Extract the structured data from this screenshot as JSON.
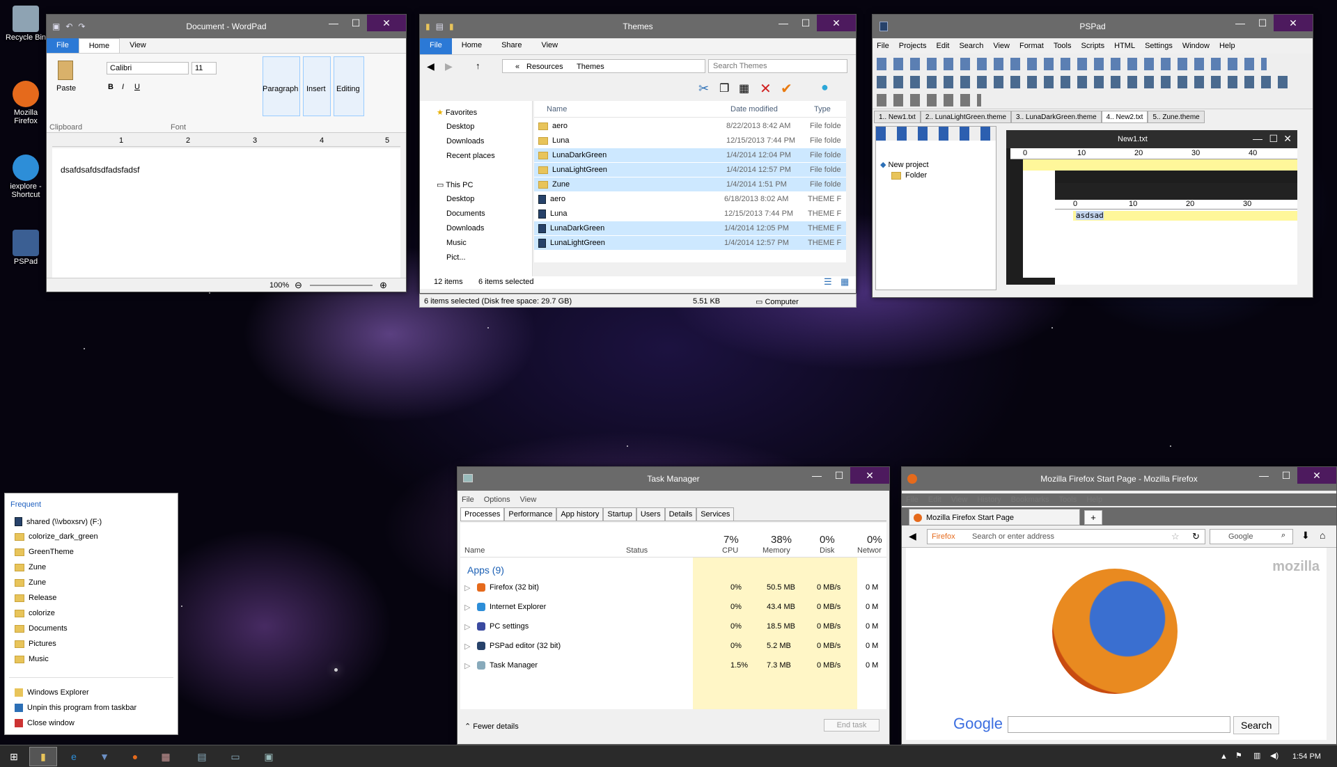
{
  "desktop": {
    "icons": [
      {
        "label": "Recycle Bin",
        "color": "#8ea3b3"
      },
      {
        "label": "Mozilla Firefox",
        "color": "#e56a1c"
      },
      {
        "label": "iexplore - Shortcut",
        "color": "#2d8ed8"
      },
      {
        "label": "PSPad",
        "color": "#3b5f93"
      }
    ]
  },
  "wordpad": {
    "title": "Document - WordPad",
    "tabs": [
      "File",
      "Home",
      "View"
    ],
    "font": "Calibri",
    "size": "11",
    "buttons": [
      "Paste",
      "Paragraph",
      "Insert",
      "Editing"
    ],
    "groups": [
      "Clipboard",
      "Font"
    ],
    "ruler": [
      "1",
      "2",
      "3",
      "4",
      "5"
    ],
    "content": "dsafdsafdsdfadsfadsf",
    "zoom": "100%"
  },
  "explorer": {
    "title": "Themes",
    "tabs": [
      "File",
      "Home",
      "Share",
      "View"
    ],
    "path": [
      "«",
      "Resources",
      "Themes"
    ],
    "search_placeholder": "Search Themes",
    "nav": {
      "favorites": "Favorites",
      "fav_items": [
        "Desktop",
        "Downloads",
        "Recent places"
      ],
      "thispc": "This PC",
      "pc_items": [
        "Desktop",
        "Documents",
        "Downloads",
        "Music",
        "Pict..."
      ]
    },
    "columns": [
      "Name",
      "Date modified",
      "Type"
    ],
    "files": [
      {
        "name": "aero",
        "date": "8/22/2013 8:42 AM",
        "type": "File folde",
        "kind": "folder",
        "sel": false
      },
      {
        "name": "Luna",
        "date": "12/15/2013 7:44 PM",
        "type": "File folde",
        "kind": "folder",
        "sel": false
      },
      {
        "name": "LunaDarkGreen",
        "date": "1/4/2014 12:04 PM",
        "type": "File folde",
        "kind": "folder",
        "sel": true
      },
      {
        "name": "LunaLightGreen",
        "date": "1/4/2014 12:57 PM",
        "type": "File folde",
        "kind": "folder",
        "sel": true
      },
      {
        "name": "Zune",
        "date": "1/4/2014 1:51 PM",
        "type": "File folde",
        "kind": "folder",
        "sel": true
      },
      {
        "name": "aero",
        "date": "6/18/2013 8:02 AM",
        "type": "THEME F",
        "kind": "theme",
        "sel": false
      },
      {
        "name": "Luna",
        "date": "12/15/2013 7:44 PM",
        "type": "THEME F",
        "kind": "theme",
        "sel": false
      },
      {
        "name": "LunaDarkGreen",
        "date": "1/4/2014 12:05 PM",
        "type": "THEME F",
        "kind": "theme",
        "sel": true
      },
      {
        "name": "LunaLightGreen",
        "date": "1/4/2014 12:57 PM",
        "type": "THEME F",
        "kind": "theme",
        "sel": true
      }
    ],
    "status_items": "12 items",
    "status_sel": "6 items selected",
    "status_bar": "6 items selected (Disk free space: 29.7 GB)",
    "status_size": "5.51 KB",
    "status_loc": "Computer"
  },
  "pspad": {
    "title": "PSPad",
    "menu": [
      "File",
      "Projects",
      "Edit",
      "Search",
      "View",
      "Format",
      "Tools",
      "Scripts",
      "HTML",
      "Settings",
      "Window",
      "Help"
    ],
    "tabs": [
      "1.. New1.txt",
      "2.. LunaLightGreen.theme",
      "3.. LunaDarkGreen.theme",
      "4.. New2.txt",
      "5.. Zune.theme"
    ],
    "tree": [
      "New project",
      "Folder"
    ],
    "inner_title": "New1.txt",
    "ruler": [
      "0",
      "10",
      "20",
      "30",
      "40"
    ],
    "ruler2": [
      "0",
      "10",
      "20",
      "30"
    ],
    "content": "asdsad"
  },
  "taskmgr": {
    "title": "Task Manager",
    "menu": [
      "File",
      "Options",
      "View"
    ],
    "tabs": [
      "Processes",
      "Performance",
      "App history",
      "Startup",
      "Users",
      "Details",
      "Services"
    ],
    "cols": {
      "name": "Name",
      "status": "Status",
      "cpu_pct": "7%",
      "cpu": "CPU",
      "mem_pct": "38%",
      "mem": "Memory",
      "disk_pct": "0%",
      "disk": "Disk",
      "net_pct": "0%",
      "net": "Networ"
    },
    "group": "Apps (9)",
    "rows": [
      {
        "name": "Firefox (32 bit)",
        "cpu": "0%",
        "mem": "50.5 MB",
        "disk": "0 MB/s",
        "net": "0 M"
      },
      {
        "name": "Internet Explorer",
        "cpu": "0%",
        "mem": "43.4 MB",
        "disk": "0 MB/s",
        "net": "0 M"
      },
      {
        "name": "PC settings",
        "cpu": "0%",
        "mem": "18.5 MB",
        "disk": "0 MB/s",
        "net": "0 M"
      },
      {
        "name": "PSPad editor (32 bit)",
        "cpu": "0%",
        "mem": "5.2 MB",
        "disk": "0 MB/s",
        "net": "0 M"
      },
      {
        "name": "Task Manager",
        "cpu": "1.5%",
        "mem": "7.3 MB",
        "disk": "0 MB/s",
        "net": "0 M"
      }
    ],
    "fewer": "Fewer details",
    "end": "End task"
  },
  "firefox": {
    "title": "Mozilla Firefox Start Page - Mozilla Firefox",
    "menu": [
      "File",
      "Edit",
      "View",
      "History",
      "Bookmarks",
      "Tools",
      "Help"
    ],
    "tab": "Mozilla Firefox Start Page",
    "url_label": "Firefox",
    "url_placeholder": "Search or enter address",
    "search_placeholder": "Google",
    "brand": "mozilla",
    "google": "Google",
    "search_btn": "Search"
  },
  "jumplist": {
    "header": "Frequent",
    "items": [
      "shared (\\\\vboxsrv) (F:)",
      "colorize_dark_green",
      "GreenTheme",
      "Zune",
      "Zune",
      "Release",
      "colorize",
      "Documents",
      "Pictures",
      "Music"
    ],
    "tasks": [
      "Windows Explorer",
      "Unpin this program from taskbar",
      "Close window"
    ]
  },
  "taskbar": {
    "time": "1:54 PM"
  }
}
